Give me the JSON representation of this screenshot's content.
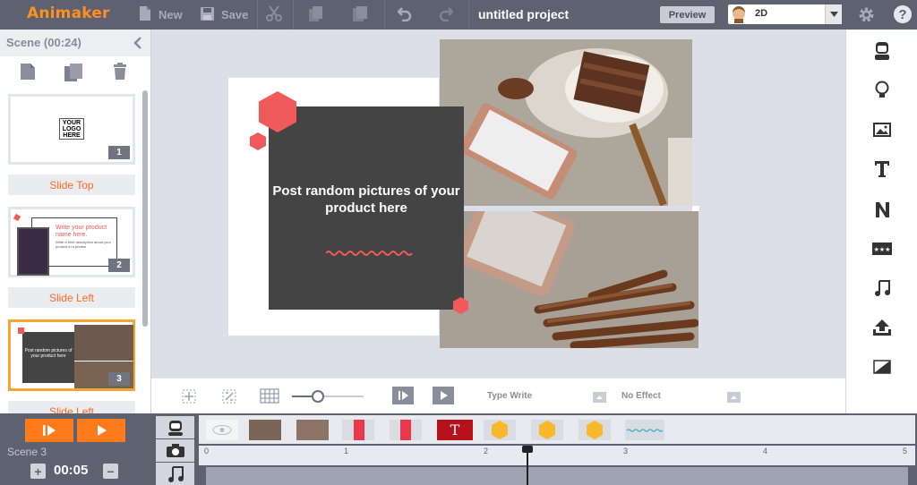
{
  "app": {
    "logo": "Animaker",
    "project_title": "untitled project"
  },
  "toolbar": {
    "new_label": "New",
    "save_label": "Save",
    "preview_label": "Preview",
    "mode_value": "2D"
  },
  "scene_panel": {
    "title": "Scene   (00:24)",
    "slides": [
      {
        "num": "1",
        "logo_text": "YOUR LOGO HERE",
        "transition": "Slide Top"
      },
      {
        "num": "2",
        "headline": "Write your product name here.",
        "body": "Write a brief description about your product in a phrase.",
        "transition": "Slide Left"
      },
      {
        "num": "3",
        "caption": "Post random pictures of your product here",
        "transition": "Slide Left"
      }
    ]
  },
  "canvas": {
    "main_text": "Post random pictures of your product here",
    "effect_in_label": "Type Write",
    "effect_out_label": "No Effect",
    "zoom_level": 0.33
  },
  "timeline": {
    "scene_label": "Scene  3",
    "duration": "00:05",
    "ticks": [
      "0",
      "1",
      "2",
      "3",
      "4",
      "5"
    ],
    "playhead_position_seconds": 2.3,
    "items": [
      "eye",
      "photo",
      "photo",
      "red-block",
      "red-block",
      "text",
      "hex",
      "hex",
      "hex",
      "wave"
    ]
  },
  "colors": {
    "accent_orange": "#ff7a1a",
    "topbar": "#5e6170",
    "hexagon": "#f05a5a",
    "dark_box": "#444444"
  }
}
